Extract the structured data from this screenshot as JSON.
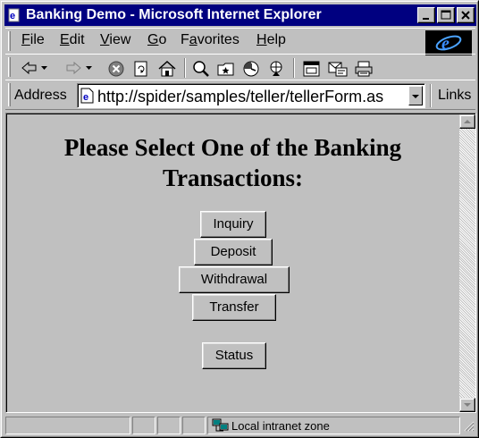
{
  "window": {
    "title": "Banking Demo - Microsoft Internet Explorer",
    "title_bar_color": "#000080"
  },
  "caption_buttons": [
    "minimize-icon",
    "maximize-icon",
    "close-icon"
  ],
  "menu": {
    "items": [
      {
        "label_u": "F",
        "label_rest": "ile"
      },
      {
        "label_u": "E",
        "label_rest": "dit"
      },
      {
        "label_u": "V",
        "label_rest": "iew"
      },
      {
        "label_u": "G",
        "label_rest": "o"
      },
      {
        "label_pre": "F",
        "label_u": "a",
        "label_rest": "vorites"
      },
      {
        "label_u": "H",
        "label_rest": "elp"
      }
    ]
  },
  "toolbar": {
    "icons": [
      "back-icon",
      "forward-icon",
      "stop-icon",
      "refresh-icon",
      "home-icon",
      "search-icon",
      "favorites-icon",
      "history-icon",
      "channels-icon",
      "fullscreen-icon",
      "mail-icon",
      "print-icon"
    ]
  },
  "address_bar": {
    "label_pre": "A",
    "label_u": "d",
    "label_rest": "dress",
    "url": "http://spider/samples/teller/tellerForm.as",
    "links_label": "Links"
  },
  "page": {
    "heading": "Please Select One of the Banking Transactions:",
    "buttons": {
      "inquiry": "Inquiry",
      "deposit": "Deposit",
      "withdrawal": "Withdrawal",
      "transfer": "Transfer",
      "status": "Status"
    }
  },
  "status_bar": {
    "zone": "Local intranet zone"
  }
}
